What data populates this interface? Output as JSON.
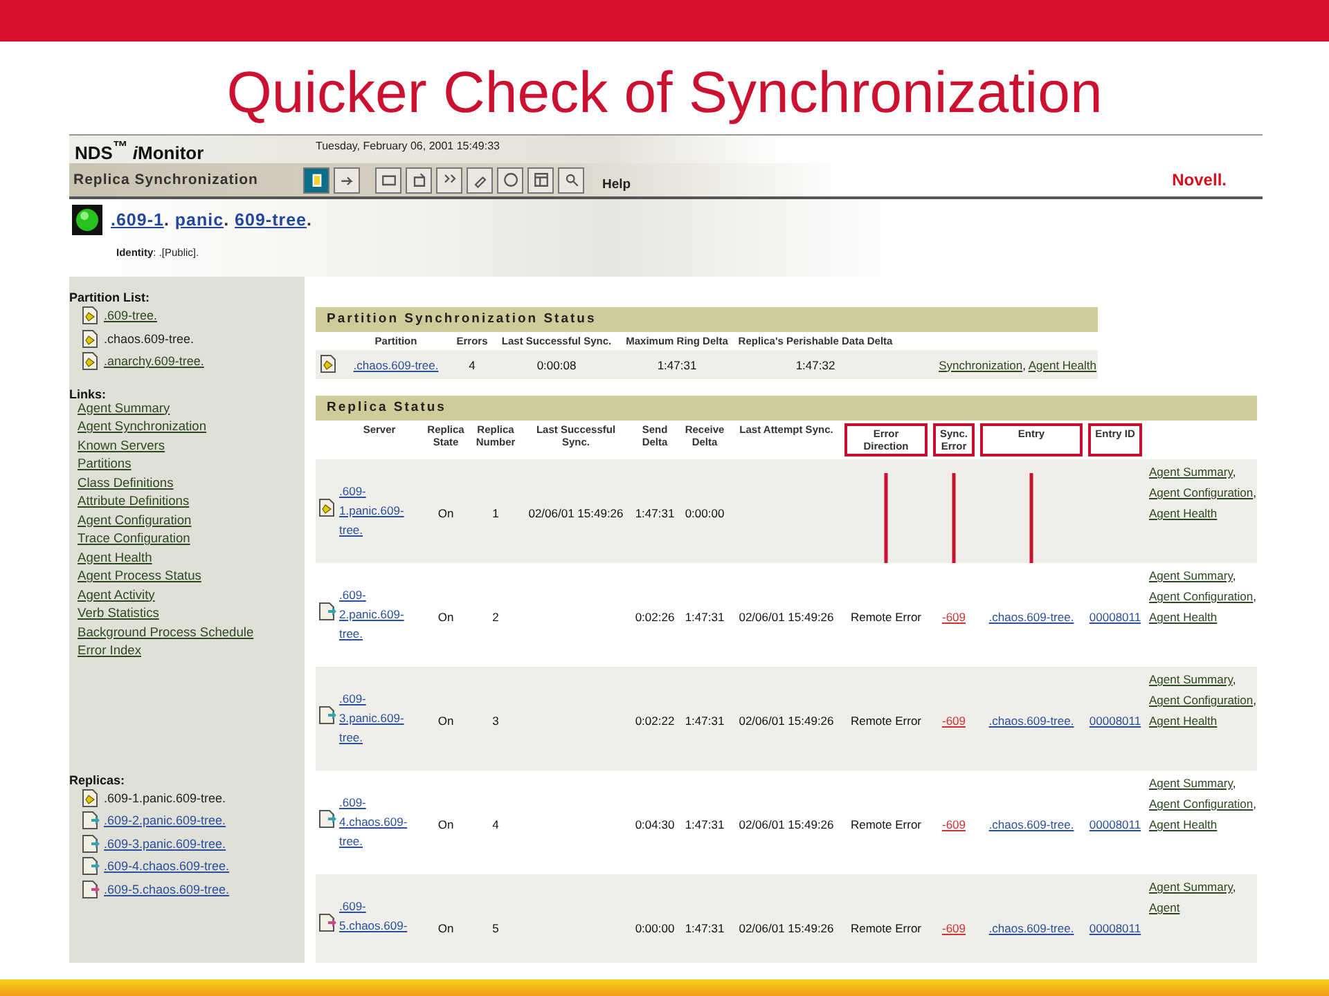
{
  "slide_title": "Quicker Check of Synchronization",
  "app": {
    "product": "NDS$^{™}$",
    "name": "iMonitor",
    "datetime": "Tuesday, February 06, 2001 15:49:33",
    "page_title": "Replica Synchronization",
    "help": "Help",
    "brand": "Novell."
  },
  "context": {
    "separator": ".",
    "parts": [
      ".609-1",
      "panic",
      "609-tree"
    ],
    "identity": "**Identity**: .[Public]."
  },
  "sidebar": {
    "partition_list": {
      "label": "Partition List:",
      "items": [
        {
          "text": ".609-tree.",
          "selected": false
        },
        {
          "text": ".chaos.609-tree.",
          "selected": true
        },
        {
          "text": ".anarchy.609-tree.",
          "selected": false
        }
      ]
    },
    "links": {
      "label": "Links:",
      "items": [
        "Agent Summary",
        "Agent Synchronization",
        "Known Servers",
        "Partitions",
        "Class Definitions",
        "Attribute Definitions",
        "Agent Configuration",
        "Trace Configuration",
        "Agent Health",
        "Agent Process Status",
        "Agent Activity",
        "Verb Statistics",
        "Background Process Schedule",
        "Error Index"
      ]
    },
    "replicas": {
      "label": "Replicas:",
      "items": [
        {
          "text": ".609-1.panic.609-tree.",
          "selected": true
        },
        {
          "text": ".609-2.panic.609-tree.",
          "selected": false
        },
        {
          "text": ".609-3.panic.609-tree.",
          "selected": false
        },
        {
          "text": ".609-4.chaos.609-tree.",
          "selected": false
        },
        {
          "text": ".609-5.chaos.609-tree.",
          "selected": false
        }
      ]
    }
  },
  "link_separator": ",",
  "partition_status": {
    "title": "Partition Synchronization Status",
    "columns": [
      "Partition",
      "Errors",
      "Last Successful Sync.",
      "Maximum Ring Delta",
      "Replica's Perishable Data Delta"
    ],
    "row": {
      "partition": ".chaos.609-tree.",
      "errors": "4",
      "last_successful": "0:00:08",
      "max_ring_delta": "1:47:31",
      "perishable_delta": "1:47:32",
      "links": [
        "Synchronization",
        "Agent Health"
      ]
    }
  },
  "replica_status": {
    "title": "Replica Status",
    "columns": [
      {
        "label": "Server",
        "highlighted": false,
        "arrow": false
      },
      {
        "label": "Replica State",
        "highlighted": false,
        "arrow": false
      },
      {
        "label": "Replica Number",
        "highlighted": false,
        "arrow": false
      },
      {
        "label": "Last Successful Sync.",
        "highlighted": false,
        "arrow": false
      },
      {
        "label": "Send Delta",
        "highlighted": false,
        "arrow": false
      },
      {
        "label": "Receive Delta",
        "highlighted": false,
        "arrow": false
      },
      {
        "label": "Last Attempt Sync.",
        "highlighted": false,
        "arrow": false
      },
      {
        "label": "Error Direction",
        "highlighted": true,
        "arrow": true
      },
      {
        "label": "Sync. Error",
        "highlighted": true,
        "arrow": true
      },
      {
        "label": "Entry",
        "highlighted": true,
        "arrow": true
      },
      {
        "label": "Entry ID",
        "highlighted": true,
        "arrow": false
      }
    ],
    "rows": [
      {
        "server": ".609-1.panic.609-tree.",
        "state": "On",
        "number": "1",
        "last_successful": "02/06/01 15:49:26",
        "send_delta": "1:47:31",
        "receive_delta": "0:00:00",
        "links": [
          "Agent Summary",
          "Agent Configuration",
          "Agent Health"
        ]
      },
      {
        "server": ".609-2.panic.609-tree.",
        "state": "On",
        "number": "2",
        "send_delta": "0:02:26",
        "receive_delta": "1:47:31",
        "last_attempt": "02/06/01 15:49:26",
        "error_direction": "Remote Error",
        "sync_error": "-609",
        "entry": ".chaos.609-tree.",
        "entry_id": "00008011",
        "links": [
          "Agent Summary",
          "Agent Configuration",
          "Agent Health"
        ]
      },
      {
        "server": ".609-3.panic.609-tree.",
        "state": "On",
        "number": "3",
        "send_delta": "0:02:22",
        "receive_delta": "1:47:31",
        "last_attempt": "02/06/01 15:49:26",
        "error_direction": "Remote Error",
        "sync_error": "-609",
        "entry": ".chaos.609-tree.",
        "entry_id": "00008011",
        "links": [
          "Agent Summary",
          "Agent Configuration",
          "Agent Health"
        ]
      },
      {
        "server": ".609-4.chaos.609-tree.",
        "state": "On",
        "number": "4",
        "send_delta": "0:04:30",
        "receive_delta": "1:47:31",
        "last_attempt": "02/06/01 15:49:26",
        "error_direction": "Remote Error",
        "sync_error": "-609",
        "entry": ".chaos.609-tree.",
        "entry_id": "00008011",
        "links": [
          "Agent Summary",
          "Agent Configuration",
          "Agent Health"
        ]
      },
      {
        "server": ".609-5.chaos.609-",
        "state": "On",
        "number": "5",
        "send_delta": "0:00:00",
        "receive_delta": "1:47:31",
        "last_attempt": "02/06/01 15:49:26",
        "error_direction": "Remote Error",
        "sync_error": "-609",
        "entry": ".chaos.609-tree.",
        "entry_id": "00008011",
        "links": [
          "Agent Summary",
          "Agent"
        ]
      }
    ]
  }
}
